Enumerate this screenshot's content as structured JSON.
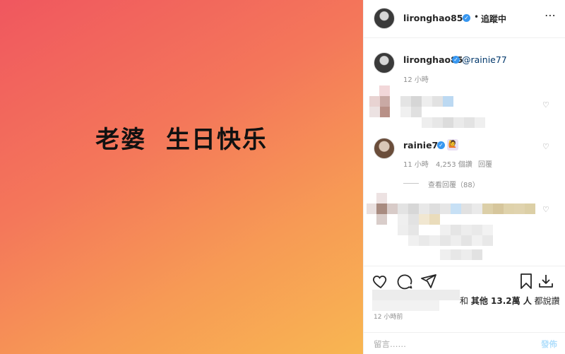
{
  "media": {
    "caption": "老婆  生日快乐"
  },
  "header": {
    "username": "lironghao85",
    "separator": "•",
    "follow_label": "追蹤中",
    "more_label": "⋯"
  },
  "caption_post": {
    "username": "lironghao85",
    "mention": "@rainie77",
    "time": "12 小時"
  },
  "reply_comment": {
    "username": "rainie77",
    "emoji": "🙋",
    "time": "11 小時",
    "likes": "4,253 個讚",
    "reply_label": "回覆",
    "view_replies": "查看回覆（88）"
  },
  "likes": {
    "and_text": "和",
    "others_text": "其他 13.2萬 人",
    "suffix": "都說讚"
  },
  "post_time": "12 小時前",
  "comment_input": {
    "placeholder": "留言……",
    "post_label": "發佈"
  },
  "colors": {
    "gradient_start": "#f0575f",
    "gradient_end": "#f8b652",
    "verified": "#3897f0",
    "link": "#00376b"
  }
}
